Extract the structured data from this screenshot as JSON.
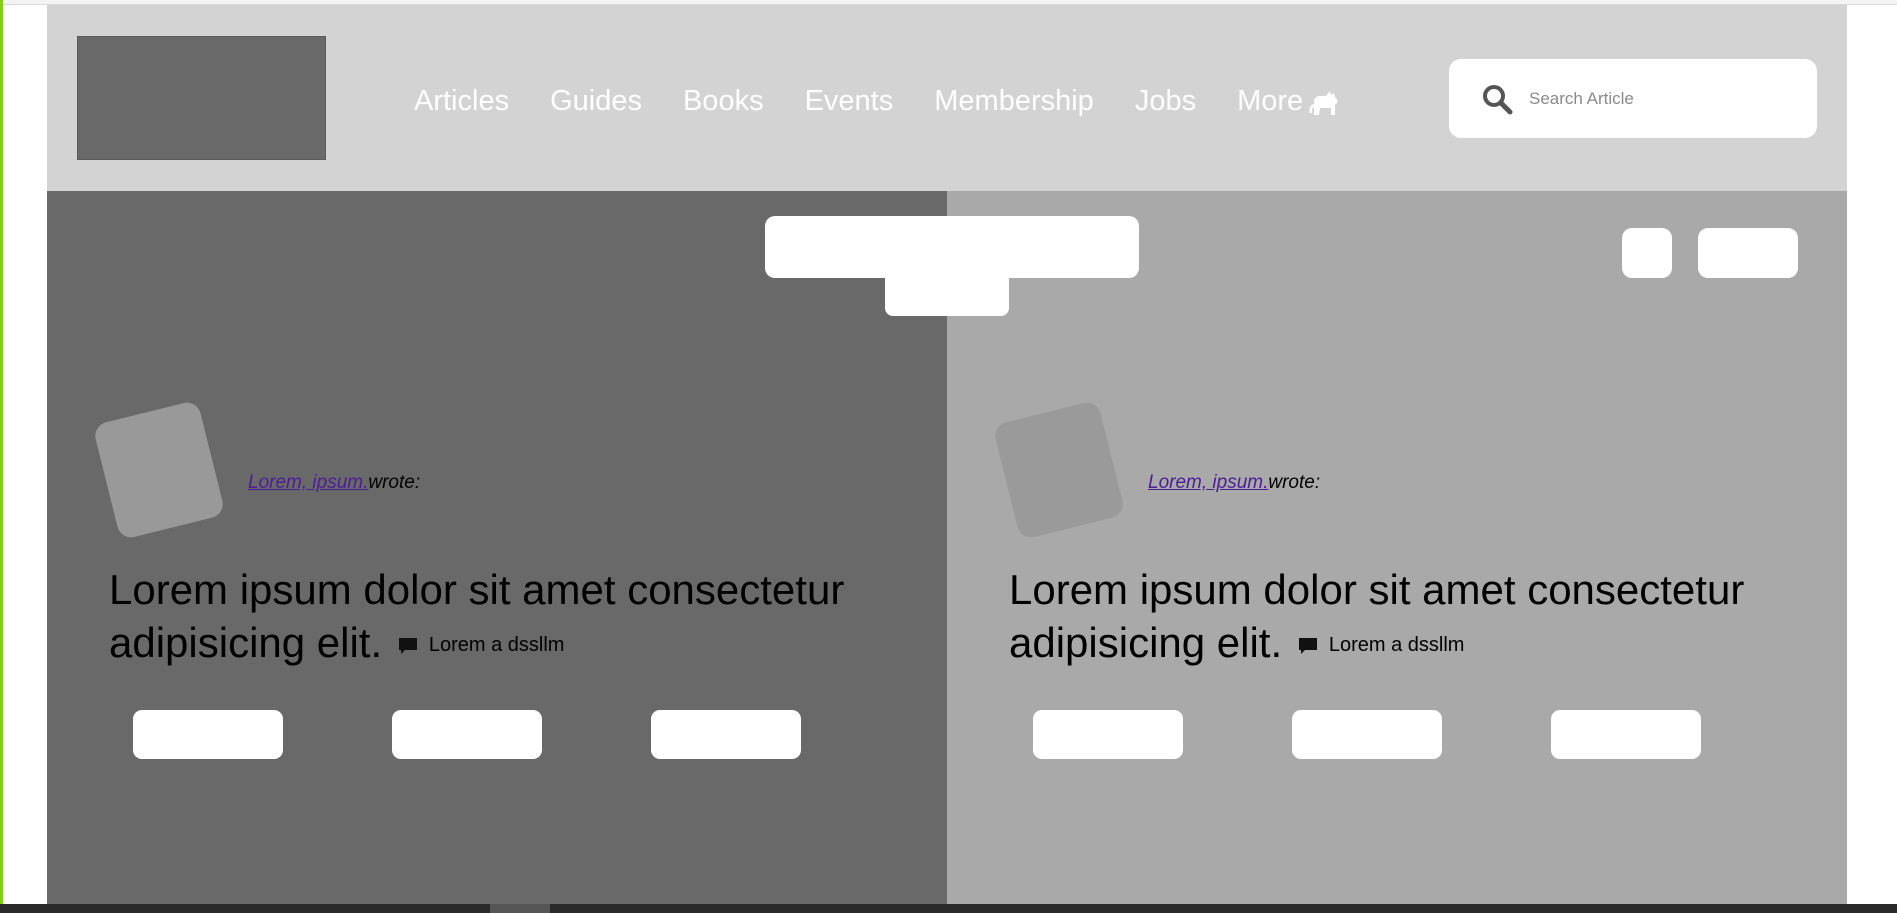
{
  "nav": {
    "items": [
      "Articles",
      "Guides",
      "Books",
      "Events",
      "Membership",
      "Jobs"
    ],
    "more_label": "More"
  },
  "search": {
    "placeholder": "Search Article",
    "value": ""
  },
  "posts": [
    {
      "author_link": "Lorem, ipsum.",
      "byline_suffix": "wrote:",
      "headline": "Lorem ipsum dolor sit amet consectetur adipisicing elit.",
      "comment_text": "Lorem a dssllm"
    },
    {
      "author_link": "Lorem, ipsum.",
      "byline_suffix": "wrote:",
      "headline": "Lorem ipsum dolor sit amet consectetur adipisicing elit.",
      "comment_text": "Lorem a dssllm"
    }
  ],
  "colors": {
    "accent": "#84cc16",
    "header_bg": "#d3d3d3",
    "left_panel_bg": "#696969",
    "right_panel_bg": "#a9a9a9",
    "link": "#4b1e96"
  },
  "icons": {
    "search": "magnifier-icon",
    "more": "cat-icon",
    "comment": "speech-bubble-icon"
  }
}
